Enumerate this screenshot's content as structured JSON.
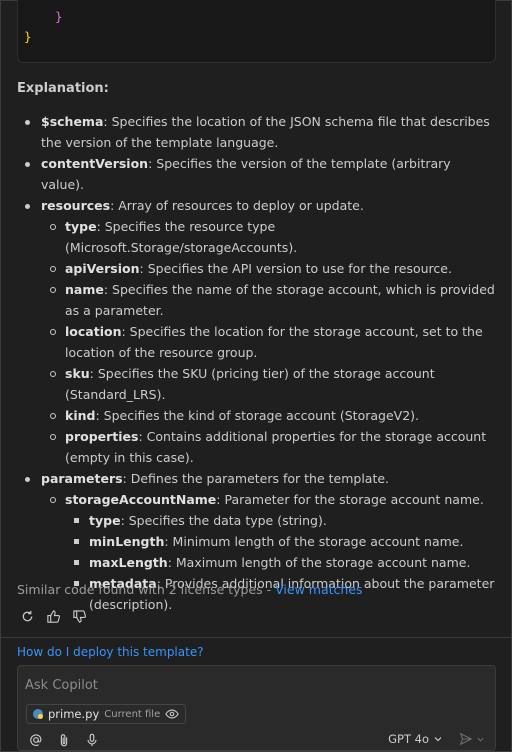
{
  "code_tail": [
    "  }",
    "}"
  ],
  "explanation_heading": "Explanation:",
  "items": [
    {
      "term": "$schema",
      "desc": ": Specifies the location of the JSON schema file that describes the version of the template language."
    },
    {
      "term": "contentVersion",
      "desc": ": Specifies the version of the template (arbitrary value)."
    },
    {
      "term": "resources",
      "desc": ": Array of resources to deploy or update.",
      "children": [
        {
          "term": "type",
          "desc": ": Specifies the resource type (Microsoft.Storage/storageAccounts)."
        },
        {
          "term": "apiVersion",
          "desc": ": Specifies the API version to use for the resource."
        },
        {
          "term": "name",
          "desc": ": Specifies the name of the storage account, which is provided as a parameter."
        },
        {
          "term": "location",
          "desc": ": Specifies the location for the storage account, set to the location of the resource group."
        },
        {
          "term": "sku",
          "desc": ": Specifies the SKU (pricing tier) of the storage account (Standard_LRS)."
        },
        {
          "term": "kind",
          "desc": ": Specifies the kind of storage account (StorageV2)."
        },
        {
          "term": "properties",
          "desc": ": Contains additional properties for the storage account (empty in this case)."
        }
      ]
    },
    {
      "term": "parameters",
      "desc": ": Defines the parameters for the template.",
      "children": [
        {
          "term": "storageAccountName",
          "desc": ": Parameter for the storage account name.",
          "children": [
            {
              "term": "type",
              "desc": ": Specifies the data type (string)."
            },
            {
              "term": "minLength",
              "desc": ": Minimum length of the storage account name."
            },
            {
              "term": "maxLength",
              "desc": ": Maximum length of the storage account name."
            },
            {
              "term": "metadata",
              "desc": ": Provides additional information about the parameter (description)."
            }
          ]
        }
      ]
    }
  ],
  "similar_code": {
    "text": "Similar code found with 2 license types - ",
    "link": "View matches"
  },
  "feedback_icons": [
    "retry-icon",
    "thumbs-up-icon",
    "thumbs-down-icon"
  ],
  "followup_question": "How do I deploy this template?",
  "chat_input": {
    "placeholder": "Ask Copilot",
    "value": ""
  },
  "attached_file": {
    "name": "prime.py",
    "label": "Current file"
  },
  "toolbar_icons": [
    "mention-icon",
    "attach-icon",
    "microphone-icon"
  ],
  "model": {
    "selected": "GPT 4o"
  },
  "colors": {
    "background": "#1f1f1f",
    "link": "#3794ff",
    "text": "#cccccc"
  }
}
